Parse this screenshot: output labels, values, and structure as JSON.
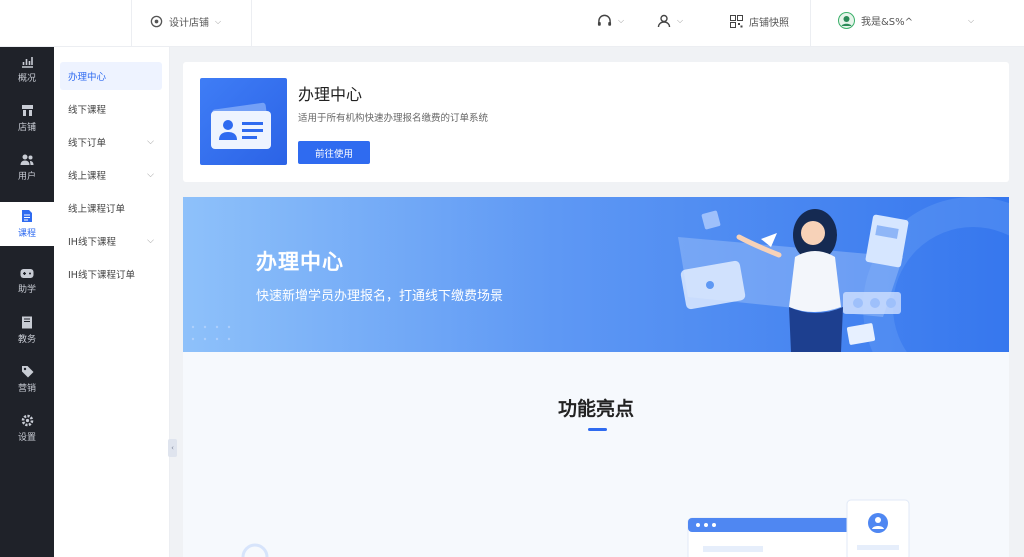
{
  "topbar": {
    "store_switch_label": "设计店铺",
    "store_desc_label": "店铺快照",
    "user_name": "我是&S%^"
  },
  "rail": {
    "items": [
      {
        "label": "概况",
        "icon": "chart-icon"
      },
      {
        "label": "店铺",
        "icon": "store-icon"
      },
      {
        "label": "用户",
        "icon": "users-icon"
      },
      {
        "label": "课程",
        "icon": "document-icon"
      },
      {
        "label": "助学",
        "icon": "gamepad-icon"
      },
      {
        "label": "教务",
        "icon": "book-icon"
      },
      {
        "label": "营销",
        "icon": "tag-icon"
      },
      {
        "label": "设置",
        "icon": "gear-icon"
      }
    ]
  },
  "submenu": {
    "items": [
      {
        "label": "办理中心",
        "expandable": false
      },
      {
        "label": "线下课程",
        "expandable": false
      },
      {
        "label": "线下订单",
        "expandable": true
      },
      {
        "label": "线上课程",
        "expandable": true
      },
      {
        "label": "线上课程订单",
        "expandable": false
      },
      {
        "label": "IH线下课程",
        "expandable": true
      },
      {
        "label": "IH线下课程订单",
        "expandable": false
      }
    ]
  },
  "card": {
    "title": "办理中心",
    "description": "适用于所有机构快速办理报名缴费的订单系统",
    "button_label": "前往使用"
  },
  "banner": {
    "title": "办理中心",
    "subtitle": "快速新增学员办理报名，打通线下缴费场景"
  },
  "features": {
    "title": "功能亮点"
  },
  "colors": {
    "accent": "#2f6bf0",
    "rail_bg": "#1f2229"
  }
}
